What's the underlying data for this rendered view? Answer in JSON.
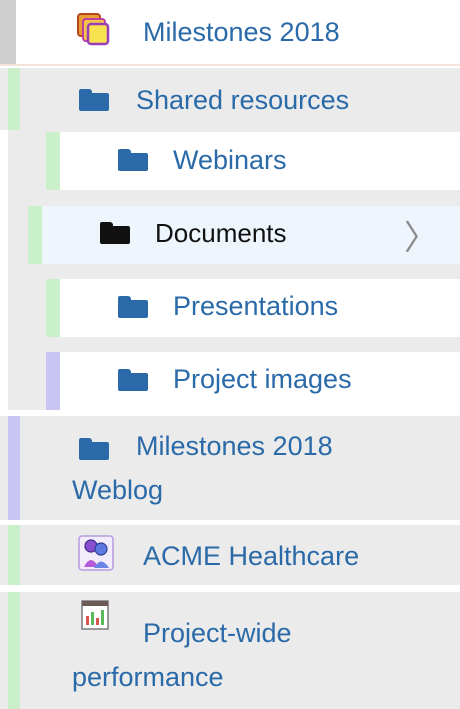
{
  "tree": {
    "items": [
      {
        "label": "Milestones 2018",
        "icon": "stacked-folders-icon"
      },
      {
        "label": "Shared resources",
        "icon": "folder-icon"
      },
      {
        "label": "Webinars",
        "icon": "folder-icon"
      },
      {
        "label": "Documents",
        "icon": "folder-icon",
        "selected": true,
        "has_children": true
      },
      {
        "label": "Presentations",
        "icon": "folder-icon"
      },
      {
        "label": "Project images",
        "icon": "folder-icon"
      },
      {
        "label_line1": "Milestones 2018",
        "label_line2": "Weblog",
        "icon": "folder-icon"
      },
      {
        "label": "ACME Healthcare",
        "icon": "group-icon"
      },
      {
        "label_line1": "Project-wide",
        "label_line2": "performance",
        "icon": "chart-icon"
      }
    ],
    "chevron": "〉"
  },
  "colors": {
    "link": "#2b6aa8",
    "selected_text": "#111111",
    "accent_green": "#c9f0c9",
    "accent_purple": "#c9c6f3",
    "accent_gray": "#cfcfcf",
    "row_gray": "#ebebeb",
    "row_selected": "#eef5fd"
  }
}
